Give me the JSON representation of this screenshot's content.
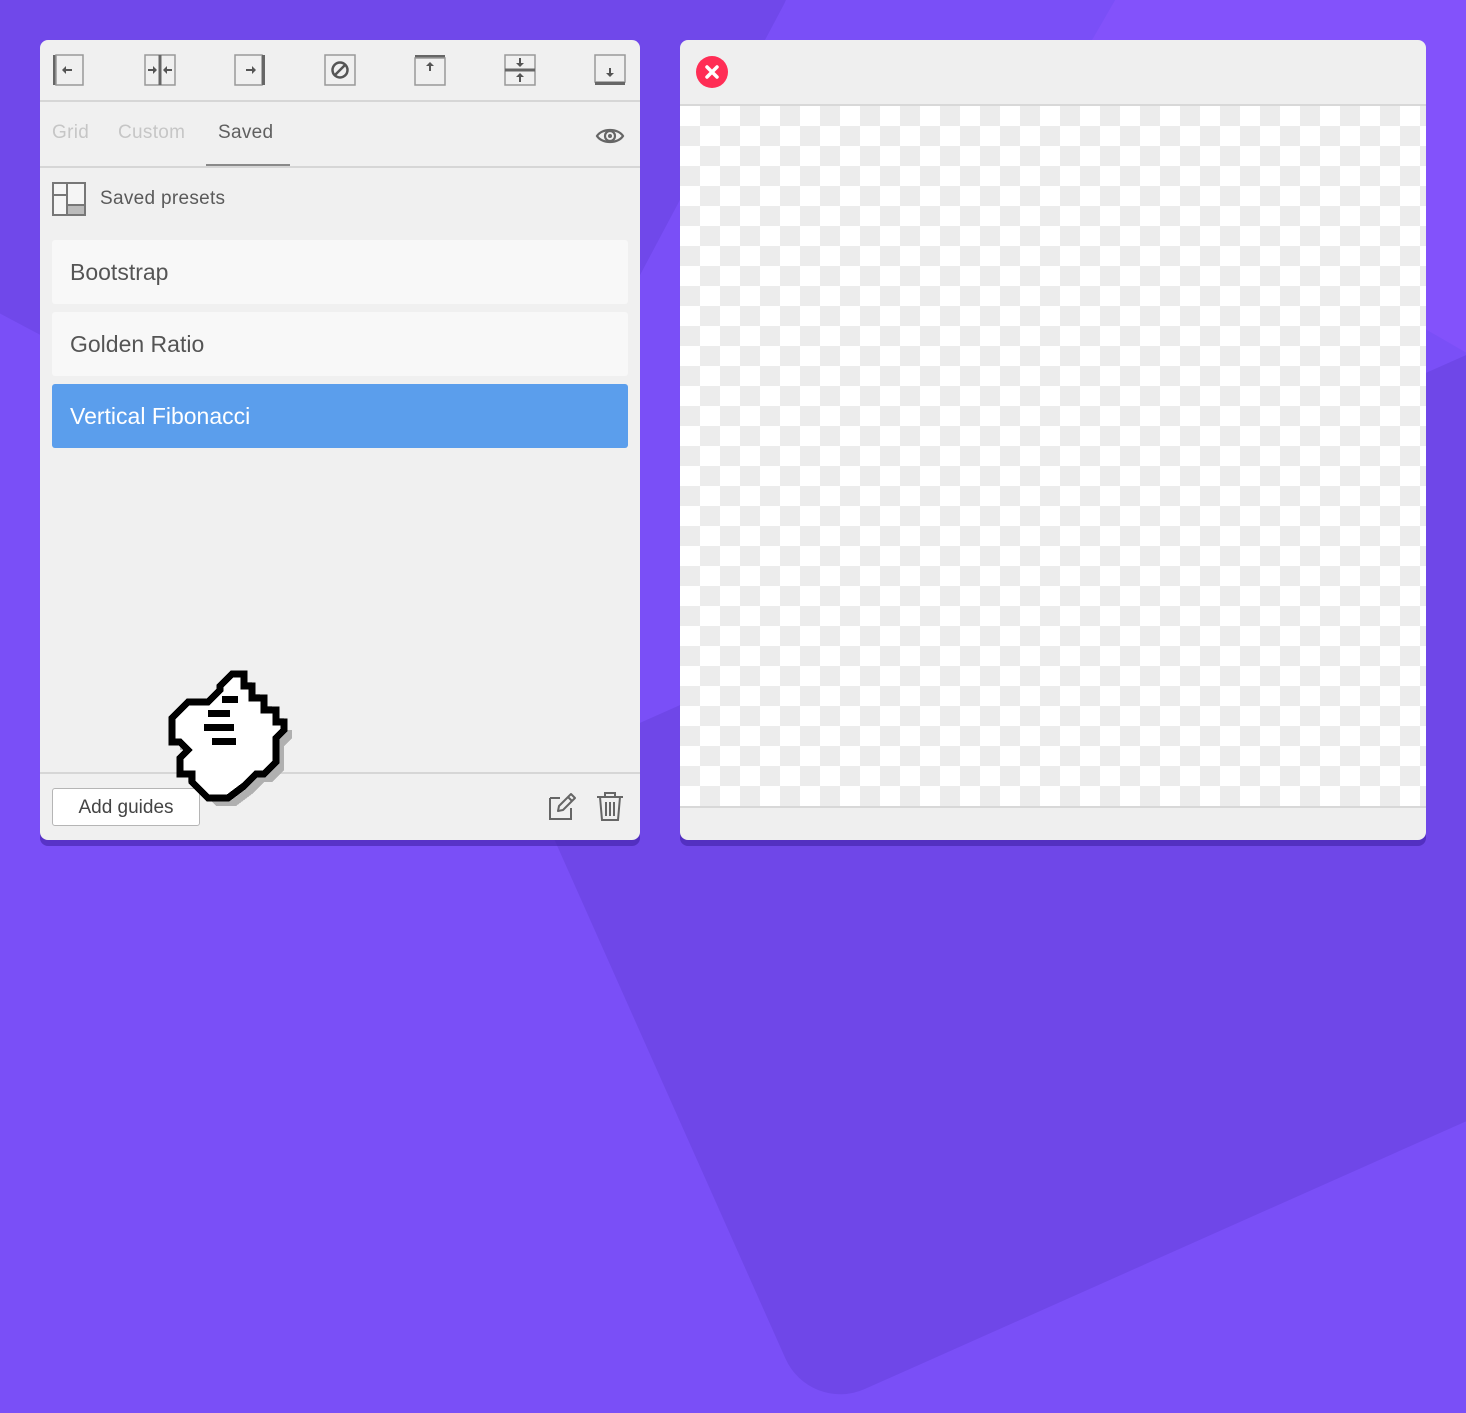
{
  "tabs": {
    "grid": "Grid",
    "custom": "Custom",
    "saved": "Saved",
    "active": "Saved"
  },
  "toolbar": {
    "icons": [
      "align-left-icon",
      "center-vertical-guides-icon",
      "align-right-icon",
      "clear-guides-icon",
      "align-top-icon",
      "center-horizontal-guides-icon",
      "align-bottom-icon"
    ]
  },
  "presets": {
    "heading": "Saved presets",
    "items": [
      {
        "label": "Bootstrap",
        "selected": false
      },
      {
        "label": "Golden Ratio",
        "selected": false
      },
      {
        "label": "Vertical Fibonacci",
        "selected": true
      }
    ]
  },
  "footer": {
    "add_label": "Add guides"
  },
  "colors": {
    "background": "#7a4ff7",
    "selected": "#5b9eec",
    "close": "#ff2d55"
  }
}
